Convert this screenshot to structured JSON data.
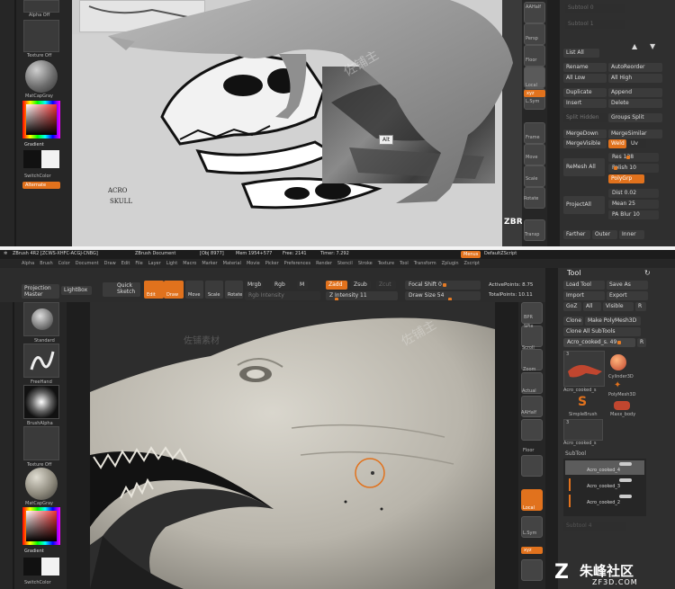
{
  "top": {
    "left_tray": {
      "top_label": "Alpha Off",
      "texture_label": "Texture Off",
      "material_label": "MatCapGray",
      "gradient_label": "Gradient",
      "switch_label": "SwitchColor",
      "alternate_label": "Alternate"
    },
    "canvas": {
      "ref_note_line1": "ACRO",
      "ref_note_line2": "SKULL",
      "tooltip": "Alt",
      "watermark_text": "佐铺主",
      "brand": "ZBRUSH WORKSHOPS"
    },
    "right_shelf": {
      "labels": [
        "AAHalf",
        "Persp",
        "Floor",
        "Local",
        "L.Sym",
        "xyz",
        "Frame",
        "Move",
        "Scale",
        "Rotate",
        "Transp"
      ]
    },
    "tool_panel": {
      "ghost_1": "Subtool 0",
      "ghost_2": "Subtool 1",
      "list_all": "List All",
      "rename": "Rename",
      "auto_reorder": "AutoReorder",
      "all_low": "All Low",
      "all_high": "All High",
      "duplicate": "Duplicate",
      "append": "Append",
      "insert": "Insert",
      "delete": "Delete",
      "split_hidden": "Split Hidden",
      "groups_split": "Groups Split",
      "merge_down": "MergeDown",
      "merge_similar": "MergeSimilar",
      "merge_visible": "MergeVisible",
      "weld": "Weld",
      "uv": "Uv",
      "remesh_all": "ReMesh All",
      "res": "Res 128",
      "polish": "Polish 10",
      "polygrp": "PolyGrp",
      "project_all": "ProjectAll",
      "dist": "Dist 0.02",
      "mean": "Mean 25",
      "pa_blur": "PA Blur 10",
      "farther": "Farther",
      "outer": "Outer",
      "inner": "Inner"
    }
  },
  "bottom": {
    "titlebar": {
      "title": "ZBrush 4R2 [ZCWS-XHFC-ACGJ-CNBG]",
      "doc": "ZBrush Document",
      "mem": "Mem 1954+577",
      "obj": "[Obj 8977]",
      "free": "Free: 2141",
      "timer": "Timer: 7.292",
      "menus_btn": "Menus",
      "script": "DefaultZScript"
    },
    "menu": [
      "Alpha",
      "Brush",
      "Color",
      "Document",
      "Draw",
      "Edit",
      "File",
      "Layer",
      "Light",
      "Macro",
      "Marker",
      "Material",
      "Movie",
      "Picker",
      "Preferences",
      "Render",
      "Stencil",
      "Stroke",
      "Texture",
      "Tool",
      "Transform",
      "Zplugin",
      "Zscript"
    ],
    "toolbar": {
      "projection_master": "Projection Master",
      "lightbox": "LightBox",
      "quick_sketch": "Quick Sketch",
      "edit": "Edit",
      "draw": "Draw",
      "move": "Move",
      "scale": "Scale",
      "rotate": "Rotate",
      "rgb_intensity": "Rgb Intensity",
      "mrgb": "Mrgb",
      "rgb": "Rgb",
      "m": "M",
      "zadd": "Zadd",
      "zsub": "Zsub",
      "zcut": "Zcut",
      "z_intensity": "Z Intensity 11",
      "focal_shift": "Focal Shift 0",
      "draw_size": "Draw Size 54",
      "active_points": "ActivePoints: 8.75",
      "total_points": "TotalPoints: 10.11"
    },
    "left_tray": {
      "brush_label": "Standard",
      "stroke_label": "FreeHand",
      "alpha_label": "BrushAlpha",
      "texture_label": "Texture Off",
      "material_label": "MatCapGray",
      "gradient_label": "Gradient",
      "switch_label": "SwitchColor"
    },
    "right_shelf": {
      "labels": [
        "BPR",
        "SPix",
        "Scroll",
        "Zoom",
        "Actual",
        "AAHalf",
        "Floor",
        "Local",
        "L.Sym",
        "xyz"
      ]
    },
    "tool_panel": {
      "header": "Tool",
      "load_tool": "Load Tool",
      "save_as": "Save As",
      "import": "Import",
      "export": "Export",
      "goz": "GoZ",
      "all": "All",
      "visible": "Visible",
      "r": "R",
      "clone": "Clone",
      "make_polymesh": "Make PolyMesh3D",
      "clone_all_subtools": "Clone  All SubTools",
      "current_tool": "Acro_cooked_s. 49",
      "r2": "R",
      "count_1": "3",
      "count_2": "3",
      "cylinder": "Cylinder3D",
      "polymesh": "PolyMesh3D",
      "simplebrush": "SimpleBrush",
      "maxx_body": "Maxx_body",
      "tool_thumb_1": "Acro_cooked_s",
      "tool_thumb_2": "Acro_cooked_s",
      "subtool_header": "SubTool",
      "subtools": [
        "Acro_cooked_4",
        "Acro_cooked_3",
        "Acro_cooked_2"
      ],
      "ghost": "Subtool 4"
    },
    "watermark": {
      "text": "佐铺主",
      "logo_text": "朱峰社区",
      "logo_url": "ZF3D.COM",
      "side_text": "佐铺素材"
    }
  },
  "colors": {
    "accent": "#e1721d",
    "panel": "#2a2a2a",
    "canvas_top": "#d9d9d9",
    "clay": "#c8c4bb"
  }
}
